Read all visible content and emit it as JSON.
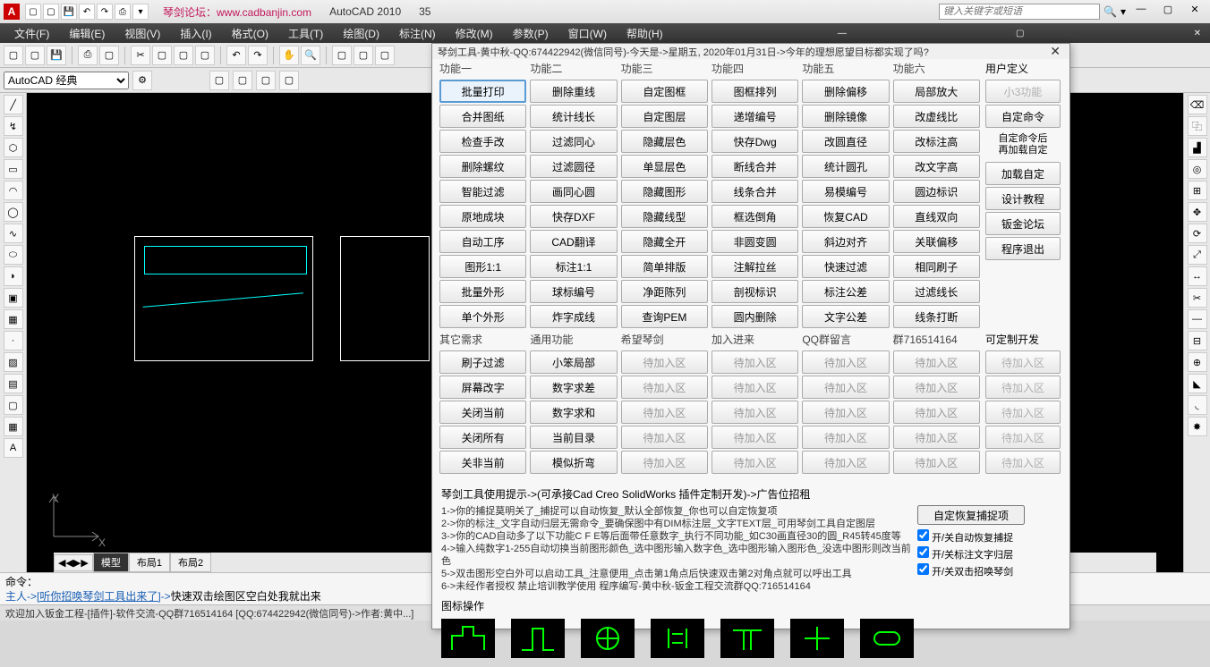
{
  "titlebar": {
    "forum": "琴剑论坛：www.cadbanjin.com",
    "app": "AutoCAD 2010",
    "doc": "35",
    "search_ph": "键入关键字或短语"
  },
  "menu": [
    "文件(F)",
    "编辑(E)",
    "视图(V)",
    "插入(I)",
    "格式(O)",
    "工具(T)",
    "绘图(D)",
    "标注(N)",
    "修改(M)",
    "参数(P)",
    "窗口(W)",
    "帮助(H)"
  ],
  "workspace": "AutoCAD 经典",
  "tabs": {
    "nav": "◀◀▶▶",
    "model": "模型",
    "l1": "布局1",
    "l2": "布局2"
  },
  "ucs": {
    "x": "X",
    "y": "Y"
  },
  "cmd": {
    "l1": "命令：",
    "prefix": "主人->",
    "msg": "[听你招唤琴剑工具出来了]",
    "arrow": "->",
    "tail": "快速双击绘图区空白处我就出来"
  },
  "status": "欢迎加入钣金工程-[插件]-软件交流-QQ群716514164  [QQ:674422942(微信同号)->作者:黄中...]",
  "dlg": {
    "title": "琴剑工具-黄中秋-QQ:674422942(微信同号)-今天是->星期五, 2020年01月31日->今年的理想愿望目标都实现了吗?",
    "sec1_h": [
      "功能一",
      "功能二",
      "功能三",
      "功能四",
      "功能五",
      "功能六"
    ],
    "sec1": [
      [
        "批量打印",
        "合并图纸",
        "检查手改",
        "删除螺纹",
        "智能过滤",
        "原地成块",
        "自动工序",
        "图形1:1",
        "批量外形",
        "单个外形"
      ],
      [
        "删除重线",
        "统计线长",
        "过滤同心",
        "过滤圆径",
        "画同心圆",
        "快存DXF",
        "CAD翻译",
        "标注1:1",
        "球标编号",
        "炸字成线"
      ],
      [
        "自定图框",
        "自定图层",
        "隐藏层色",
        "单显层色",
        "隐藏图形",
        "隐藏线型",
        "隐藏全开",
        "简单排版",
        "净距陈列",
        "查询PEM"
      ],
      [
        "图框排列",
        "递增编号",
        "快存Dwg",
        "断线合并",
        "线条合并",
        "框选倒角",
        "非圆变圆",
        "注解拉丝",
        "剖视标识",
        "圆内删除"
      ],
      [
        "删除偏移",
        "删除镜像",
        "改圆直径",
        "统计圆孔",
        "易模编号",
        "恢复CAD",
        "斜边对齐",
        "快速过滤",
        "标注公差",
        "文字公差"
      ],
      [
        "局部放大",
        "改虚线比",
        "改标注高",
        "改文字高",
        "圆边标识",
        "直线双向",
        "关联偏移",
        "相同刷子",
        "过滤线长",
        "线条打断"
      ]
    ],
    "side_h": "用户定义",
    "side": [
      "小3功能",
      "自定命令"
    ],
    "side_multi": "自定命令后\n再加载自定",
    "side2": [
      "加载自定",
      "设计教程",
      "钣金论坛",
      "程序退出"
    ],
    "sec2_h": [
      "其它需求",
      "通用功能",
      "希望琴剑",
      "加入进来",
      "QQ群留言",
      "群716514164"
    ],
    "sec2_side_h": "可定制开发",
    "sec2": [
      [
        "刷子过滤",
        "屏幕改字",
        "关闭当前",
        "关闭所有",
        "关非当前"
      ],
      [
        "小笨局部",
        "数字求差",
        "数字求和",
        "当前目录",
        "模似折弯"
      ]
    ],
    "pending": "待加入区",
    "hint": "琴剑工具使用提示->(可承接Cad Creo SolidWorks 插件定制开发)->广告位招租",
    "tips": [
      "1->你的捕捉莫明关了_捕捉可以自动恢复_默认全部恢复_你也可以自定恢复项",
      "2->你的标注_文字自动归层无需命令_要确保图中有DIM标注层_文字TEXT层_可用琴剑工具自定图层",
      "3->你的CAD自动多了以下功能C F E等后面带任意数字_执行不同功能_如C30画直径30的圆_R45转45度等",
      "4->输入纯数字1-255自动切换当前图形颜色_选中图形输入数字色_选中图形输入图形色_没选中图形则改当前色",
      "5->双击图形空白外可以启动工具_注意便用_点击第1角点后快速双击第2对角点就可以呼出工具",
      "6->未经作者授权 禁止培训教学使用 程序编写-黄中秋-钣金工程交流群QQ:716514164"
    ],
    "opt_btn": "自定恢复捕捉项",
    "opts": [
      "开/关自动恢复捕捉",
      "开/关标注文字归层",
      "开/关双击招唤琴剑"
    ],
    "shapes_h": "图标操作"
  }
}
